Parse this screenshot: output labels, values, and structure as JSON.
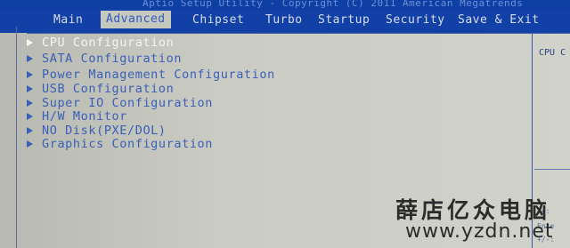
{
  "header": {
    "title": "Aptio Setup Utility - Copyright (C) 2011 American Megatrends"
  },
  "tabs": [
    {
      "label": "Main"
    },
    {
      "label": "Advanced"
    },
    {
      "label": "Chipset"
    },
    {
      "label": "Turbo"
    },
    {
      "label": "Startup"
    },
    {
      "label": "Security"
    },
    {
      "label": "Save & Exit"
    }
  ],
  "menu": [
    {
      "label": "CPU Configuration"
    },
    {
      "label": "SATA Configuration"
    },
    {
      "label": "Power Management Configuration"
    },
    {
      "label": "USB Configuration"
    },
    {
      "label": "Super IO Configuration"
    },
    {
      "label": "H/W Monitor"
    },
    {
      "label": "NO Disk(PXE/DOL)"
    },
    {
      "label": "Graphics Configuration"
    }
  ],
  "help": {
    "title": "CPU C",
    "hints": [
      "→←:",
      "Ente",
      "+/-:"
    ]
  },
  "watermark": {
    "chinese": "薛店亿众电脑",
    "url": "www.yzdn.net"
  },
  "colors": {
    "tab_bar": "#1140a7",
    "panel_bg": "#c9cac2",
    "menu_text": "#3a5fb8",
    "selected_text": "#f5f5f2"
  }
}
